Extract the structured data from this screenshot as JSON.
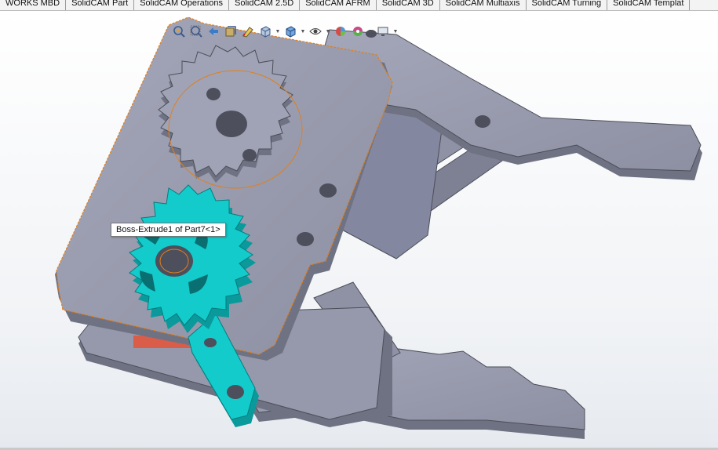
{
  "tabs": [
    {
      "label": "WORKS MBD"
    },
    {
      "label": "SolidCAM Part"
    },
    {
      "label": "SolidCAM Operations"
    },
    {
      "label": "SolidCAM 2.5D"
    },
    {
      "label": "SolidCAM AFRM"
    },
    {
      "label": "SolidCAM 3D"
    },
    {
      "label": "SolidCAM Multiaxis"
    },
    {
      "label": "SolidCAM Turning"
    },
    {
      "label": "SolidCAM Templat"
    }
  ],
  "heads_up_toolbar": [
    {
      "icon": "zoom-to-fit-icon"
    },
    {
      "icon": "zoom-to-area-icon"
    },
    {
      "icon": "previous-view-icon"
    },
    {
      "icon": "section-view-icon"
    },
    {
      "icon": "dynamic-annotation-icon"
    },
    {
      "icon": "view-orientation-icon"
    },
    {
      "icon": "display-style-icon"
    },
    {
      "icon": "hide-show-items-icon"
    },
    {
      "icon": "edit-appearance-icon"
    },
    {
      "icon": "apply-scene-icon"
    },
    {
      "icon": "view-settings-icon"
    }
  ],
  "tooltip": {
    "text": "Boss-Extrude1 of Part7<1>"
  },
  "colors": {
    "part_face": "#9a9db0",
    "part_side": "#6f7283",
    "selected_face": "#13cbcb",
    "selected_side": "#0a9a9c",
    "highlight_edge": "#e07f1e",
    "hidden_part": "#d95d48"
  }
}
